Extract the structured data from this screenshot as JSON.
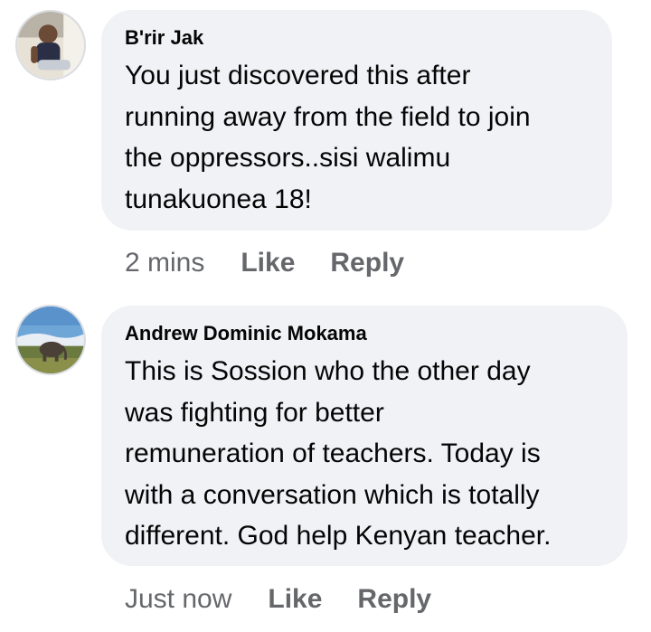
{
  "comments": [
    {
      "author": "B'rir Jak",
      "text": "You just discovered this after\nrunning away from the field to join\nthe oppressors..sisi walimu\ntunakuonea 18!",
      "time": "2 mins",
      "like_label": "Like",
      "reply_label": "Reply",
      "avatar_icon": "person-photo"
    },
    {
      "author": "Andrew Dominic Mokama",
      "text": "This is Sossion who the other day\nwas fighting for better\nremuneration of teachers. Today is\nwith a conversation which is totally\ndifferent. God help Kenyan teacher.",
      "time": "Just now",
      "like_label": "Like",
      "reply_label": "Reply",
      "avatar_icon": "elephant-landscape-photo"
    }
  ]
}
